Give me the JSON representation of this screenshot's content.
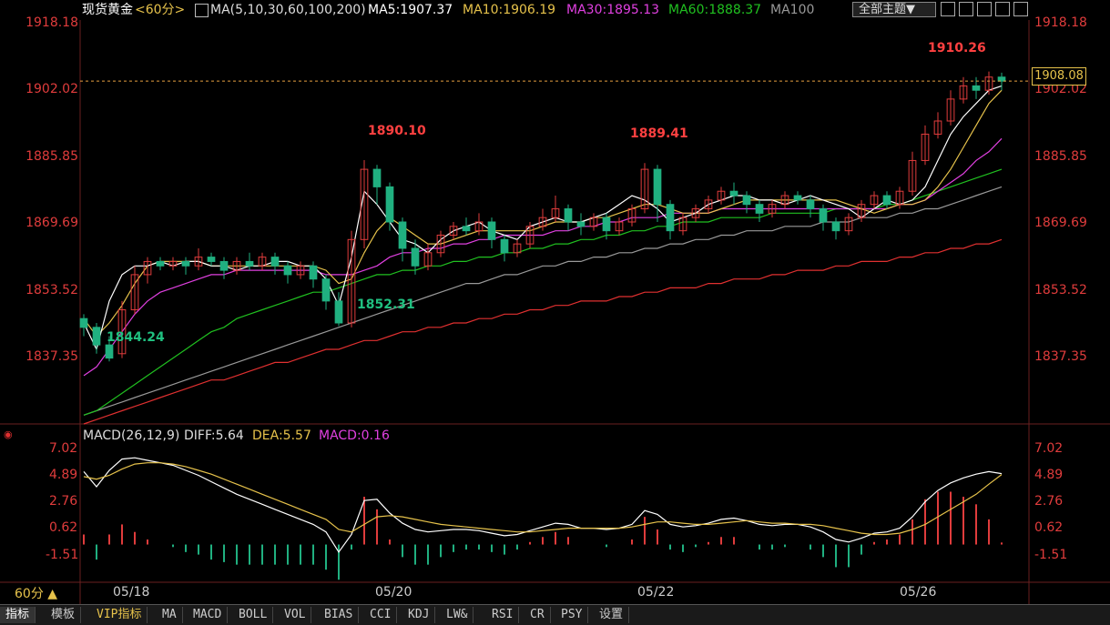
{
  "header": {
    "instrument": "现货黄金",
    "period": "<60分>",
    "ma_params": "MA(5,10,30,60,100,200)",
    "ma5": "MA5:1907.37",
    "ma10": "MA10:1906.19",
    "ma30": "MA30:1895.13",
    "ma60": "MA60:1888.37",
    "ma100": "MA100",
    "theme_button": "全部主题▼"
  },
  "colors": {
    "ma5": "#ffffff",
    "ma10": "#e6c24b",
    "ma30": "#e040e0",
    "ma60": "#20c020",
    "ma100": "#999999",
    "ma200": "#e03030",
    "up": "#e03c3c",
    "down": "#20b080"
  },
  "price_axis": {
    "labels_left": [
      "1918.18",
      "1902.02",
      "1885.85",
      "1869.69",
      "1853.52",
      "1837.35"
    ],
    "labels_right": [
      "1918.18",
      "1902.02",
      "1885.85",
      "1869.69",
      "1853.52",
      "1837.35"
    ],
    "current_price": "1908.08"
  },
  "annotations": {
    "low1": "1844.24",
    "low2": "1852.31",
    "high1": "1890.10",
    "high2": "1889.41",
    "high3": "1910.26"
  },
  "macd": {
    "title": "MACD(26,12,9)",
    "diff": "DIFF:5.64",
    "dea": "DEA:5.57",
    "macd": "MACD:0.16",
    "labels_left": [
      "7.02",
      "4.89",
      "2.76",
      "0.62",
      "-1.51"
    ],
    "labels_right": [
      "7.02",
      "4.89",
      "2.76",
      "0.62",
      "-1.51"
    ]
  },
  "xaxis": {
    "labels": [
      "05/18",
      "05/20",
      "05/22",
      "05/26"
    ]
  },
  "period_button": "60分 ▲",
  "tabs": [
    "指标",
    "模板",
    "VIP指标",
    "MA",
    "MACD",
    "BOLL",
    "VOL",
    "BIAS",
    "CCI",
    "KDJ",
    "LW&",
    "RSI",
    "CR",
    "PSY",
    "设置"
  ],
  "chart_data": [
    {
      "type": "candlestick",
      "title": "现货黄金 60分",
      "ylim": [
        1830,
        1922
      ],
      "series": [
        {
          "name": "MA5",
          "value": 1907.37
        },
        {
          "name": "MA10",
          "value": 1906.19
        },
        {
          "name": "MA30",
          "value": 1895.13
        },
        {
          "name": "MA60",
          "value": 1888.37
        },
        {
          "name": "MA100"
        }
      ],
      "ma_curves": {
        "MA5": [
          1853,
          1847,
          1858,
          1864,
          1866,
          1866,
          1867,
          1866,
          1867,
          1867,
          1866,
          1866,
          1865,
          1866,
          1866,
          1867,
          1867,
          1866,
          1866,
          1863,
          1857,
          1868,
          1883,
          1880,
          1876,
          1872,
          1871,
          1869,
          1872,
          1874,
          1875,
          1876,
          1874,
          1873,
          1872,
          1875,
          1876,
          1877,
          1876,
          1876,
          1877,
          1878,
          1880,
          1882,
          1881,
          1879,
          1876,
          1877,
          1878,
          1880,
          1881,
          1882,
          1882,
          1881,
          1881,
          1880,
          1881,
          1882,
          1881,
          1880,
          1879,
          1877,
          1879,
          1881,
          1880,
          1881,
          1884,
          1890,
          1896,
          1900,
          1903,
          1906,
          1907
        ],
        "MA10": [
          1854,
          1850,
          1853,
          1857,
          1862,
          1866,
          1867,
          1867,
          1867,
          1867,
          1866,
          1866,
          1866,
          1866,
          1866,
          1866,
          1866,
          1866,
          1866,
          1865,
          1862,
          1863,
          1869,
          1874,
          1877,
          1875,
          1873,
          1871,
          1871,
          1872,
          1873,
          1874,
          1874,
          1874,
          1874,
          1874,
          1875,
          1876,
          1876,
          1876,
          1877,
          1877,
          1878,
          1879,
          1880,
          1880,
          1879,
          1878,
          1878,
          1878,
          1879,
          1880,
          1881,
          1881,
          1881,
          1881,
          1881,
          1881,
          1881,
          1881,
          1880,
          1879,
          1878,
          1879,
          1880,
          1880,
          1881,
          1884,
          1888,
          1893,
          1898,
          1903,
          1906
        ],
        "MA30": [
          1841,
          1843,
          1847,
          1851,
          1855,
          1858,
          1860,
          1861,
          1862,
          1863,
          1864,
          1864,
          1865,
          1865,
          1865,
          1865,
          1865,
          1865,
          1865,
          1864,
          1864,
          1864,
          1865,
          1866,
          1868,
          1869,
          1869,
          1870,
          1870,
          1871,
          1871,
          1872,
          1872,
          1873,
          1873,
          1873,
          1873,
          1874,
          1874,
          1875,
          1875,
          1876,
          1876,
          1877,
          1877,
          1877,
          1878,
          1878,
          1878,
          1878,
          1879,
          1879,
          1879,
          1879,
          1879,
          1879,
          1879,
          1879,
          1879,
          1879,
          1879,
          1879,
          1879,
          1879,
          1880,
          1880,
          1881,
          1883,
          1885,
          1887,
          1890,
          1892,
          1895
        ],
        "MA60": [
          1832,
          1833,
          1835,
          1837,
          1839,
          1841,
          1843,
          1845,
          1847,
          1849,
          1851,
          1852,
          1854,
          1855,
          1856,
          1857,
          1858,
          1859,
          1860,
          1860,
          1861,
          1862,
          1863,
          1864,
          1864,
          1865,
          1865,
          1866,
          1866,
          1867,
          1867,
          1868,
          1868,
          1869,
          1869,
          1870,
          1870,
          1871,
          1871,
          1872,
          1872,
          1873,
          1873,
          1874,
          1874,
          1875,
          1875,
          1876,
          1876,
          1876,
          1877,
          1877,
          1877,
          1877,
          1878,
          1878,
          1878,
          1878,
          1878,
          1879,
          1879,
          1879,
          1879,
          1880,
          1880,
          1881,
          1882,
          1883,
          1884,
          1885,
          1886,
          1887,
          1888
        ],
        "MA100": [
          1832,
          1833,
          1834,
          1835,
          1836,
          1837,
          1838,
          1839,
          1840,
          1841,
          1842,
          1843,
          1844,
          1845,
          1846,
          1847,
          1848,
          1849,
          1850,
          1851,
          1852,
          1853,
          1854,
          1855,
          1856,
          1857,
          1858,
          1859,
          1860,
          1861,
          1862,
          1862,
          1863,
          1864,
          1864,
          1865,
          1866,
          1866,
          1867,
          1867,
          1868,
          1868,
          1869,
          1869,
          1870,
          1870,
          1871,
          1871,
          1872,
          1872,
          1873,
          1873,
          1874,
          1874,
          1874,
          1875,
          1875,
          1875,
          1876,
          1876,
          1876,
          1877,
          1877,
          1877,
          1878,
          1878,
          1879,
          1879,
          1880,
          1881,
          1882,
          1883,
          1884
        ],
        "MA200": [
          1830,
          1831,
          1832,
          1833,
          1834,
          1835,
          1836,
          1837,
          1838,
          1839,
          1840,
          1840,
          1841,
          1842,
          1843,
          1844,
          1844,
          1845,
          1846,
          1847,
          1847,
          1848,
          1849,
          1849,
          1850,
          1851,
          1851,
          1852,
          1852,
          1853,
          1853,
          1854,
          1854,
          1855,
          1855,
          1856,
          1856,
          1857,
          1857,
          1858,
          1858,
          1858,
          1859,
          1859,
          1860,
          1860,
          1861,
          1861,
          1861,
          1862,
          1862,
          1863,
          1863,
          1863,
          1864,
          1864,
          1865,
          1865,
          1865,
          1866,
          1866,
          1867,
          1867,
          1867,
          1868,
          1868,
          1869,
          1869,
          1870,
          1870,
          1871,
          1871,
          1872
        ]
      },
      "candles": [
        [
          1854,
          1852,
          1855,
          1850
        ],
        [
          1852,
          1848,
          1853,
          1846
        ],
        [
          1848,
          1845,
          1850,
          1844.24
        ],
        [
          1846,
          1856,
          1858,
          1845
        ],
        [
          1856,
          1864,
          1866,
          1855
        ],
        [
          1864,
          1867,
          1868,
          1862
        ],
        [
          1867,
          1866,
          1868,
          1865
        ],
        [
          1866,
          1867,
          1868,
          1865
        ],
        [
          1867,
          1866,
          1868,
          1864
        ],
        [
          1866,
          1868,
          1870,
          1865
        ],
        [
          1868,
          1867,
          1869,
          1866
        ],
        [
          1867,
          1865,
          1868,
          1863
        ],
        [
          1865,
          1867,
          1868,
          1864
        ],
        [
          1867,
          1866,
          1869,
          1865
        ],
        [
          1866,
          1868,
          1869,
          1865
        ],
        [
          1868,
          1866,
          1869,
          1864
        ],
        [
          1866,
          1864,
          1867,
          1862
        ],
        [
          1864,
          1866,
          1867,
          1863
        ],
        [
          1866,
          1863,
          1867,
          1861
        ],
        [
          1863,
          1858,
          1864,
          1856
        ],
        [
          1858,
          1853,
          1860,
          1852.31
        ],
        [
          1853,
          1872,
          1874,
          1852
        ],
        [
          1872,
          1888,
          1890.1,
          1870
        ],
        [
          1888,
          1884,
          1889,
          1880
        ],
        [
          1884,
          1876,
          1885,
          1874
        ],
        [
          1876,
          1870,
          1877,
          1867
        ],
        [
          1870,
          1866,
          1872,
          1864
        ],
        [
          1866,
          1869,
          1871,
          1865
        ],
        [
          1869,
          1873,
          1874,
          1868
        ],
        [
          1873,
          1875,
          1876,
          1872
        ],
        [
          1875,
          1874,
          1877,
          1873
        ],
        [
          1874,
          1876,
          1878,
          1873
        ],
        [
          1876,
          1872,
          1877,
          1870
        ],
        [
          1872,
          1869,
          1873,
          1867
        ],
        [
          1869,
          1871,
          1872,
          1868
        ],
        [
          1871,
          1875,
          1876,
          1870
        ],
        [
          1875,
          1877,
          1879,
          1874
        ],
        [
          1877,
          1879,
          1882,
          1876
        ],
        [
          1879,
          1876,
          1880,
          1874
        ],
        [
          1876,
          1875,
          1878,
          1873
        ],
        [
          1875,
          1877,
          1878,
          1874
        ],
        [
          1877,
          1874,
          1878,
          1872
        ],
        [
          1874,
          1876,
          1877,
          1873
        ],
        [
          1876,
          1879,
          1880,
          1875
        ],
        [
          1879,
          1888,
          1889.41,
          1878
        ],
        [
          1888,
          1880,
          1889,
          1876
        ],
        [
          1880,
          1874,
          1881,
          1872
        ],
        [
          1874,
          1877,
          1878,
          1873
        ],
        [
          1877,
          1879,
          1880,
          1876
        ],
        [
          1879,
          1881,
          1882,
          1878
        ],
        [
          1881,
          1883,
          1884,
          1880
        ],
        [
          1883,
          1882,
          1885,
          1880
        ],
        [
          1882,
          1880,
          1883,
          1878
        ],
        [
          1880,
          1878,
          1881,
          1876
        ],
        [
          1878,
          1880,
          1881,
          1877
        ],
        [
          1880,
          1882,
          1883,
          1879
        ],
        [
          1882,
          1881,
          1883,
          1880
        ],
        [
          1881,
          1879,
          1882,
          1877
        ],
        [
          1879,
          1876,
          1880,
          1874
        ],
        [
          1876,
          1874,
          1877,
          1872
        ],
        [
          1874,
          1877,
          1878,
          1873
        ],
        [
          1877,
          1880,
          1881,
          1876
        ],
        [
          1880,
          1882,
          1883,
          1879
        ],
        [
          1882,
          1880,
          1883,
          1879
        ],
        [
          1880,
          1883,
          1884,
          1879
        ],
        [
          1883,
          1890,
          1892,
          1882
        ],
        [
          1890,
          1896,
          1898,
          1889
        ],
        [
          1896,
          1899,
          1901,
          1895
        ],
        [
          1899,
          1904,
          1906,
          1898
        ],
        [
          1904,
          1907,
          1909,
          1903
        ],
        [
          1907,
          1906,
          1909,
          1904
        ],
        [
          1906,
          1909,
          1910.26,
          1905
        ],
        [
          1909,
          1908.08,
          1910,
          1906
        ]
      ]
    },
    {
      "type": "macd",
      "title": "MACD(26,12,9)",
      "ylim": [
        -3,
        8
      ],
      "series": [
        {
          "name": "DIFF",
          "value": 5.64
        },
        {
          "name": "DEA",
          "value": 5.57
        },
        {
          "name": "MACD",
          "value": 0.16
        }
      ],
      "diff": [
        5.8,
        4.6,
        5.9,
        6.8,
        6.9,
        6.7,
        6.5,
        6.3,
        5.9,
        5.5,
        5.0,
        4.5,
        4.0,
        3.6,
        3.2,
        2.8,
        2.4,
        2.0,
        1.6,
        1.0,
        -0.6,
        0.8,
        3.5,
        3.6,
        2.5,
        1.7,
        1.2,
        1.0,
        1.1,
        1.2,
        1.2,
        1.1,
        0.9,
        0.7,
        0.8,
        1.1,
        1.4,
        1.7,
        1.6,
        1.3,
        1.3,
        1.2,
        1.3,
        1.6,
        2.7,
        2.4,
        1.6,
        1.4,
        1.5,
        1.7,
        2.0,
        2.1,
        1.9,
        1.6,
        1.5,
        1.6,
        1.6,
        1.4,
        1.0,
        0.4,
        0.2,
        0.5,
        0.9,
        1.0,
        1.3,
        2.2,
        3.4,
        4.3,
        4.9,
        5.3,
        5.6,
        5.8,
        5.64
      ],
      "dea": [
        5.4,
        5.2,
        5.5,
        6.0,
        6.4,
        6.5,
        6.5,
        6.4,
        6.2,
        5.9,
        5.6,
        5.2,
        4.8,
        4.4,
        4.0,
        3.6,
        3.2,
        2.8,
        2.4,
        2.0,
        1.2,
        1.0,
        1.6,
        2.2,
        2.3,
        2.2,
        2.0,
        1.8,
        1.6,
        1.5,
        1.4,
        1.3,
        1.2,
        1.1,
        1.0,
        1.0,
        1.1,
        1.2,
        1.3,
        1.3,
        1.3,
        1.3,
        1.3,
        1.4,
        1.6,
        1.8,
        1.8,
        1.7,
        1.6,
        1.6,
        1.7,
        1.8,
        1.9,
        1.8,
        1.7,
        1.7,
        1.6,
        1.6,
        1.5,
        1.3,
        1.1,
        0.9,
        0.8,
        0.8,
        0.9,
        1.2,
        1.6,
        2.2,
        2.8,
        3.4,
        4.0,
        4.8,
        5.57
      ],
      "macd": [
        0.8,
        -1.2,
        0.8,
        1.6,
        1.0,
        0.4,
        0,
        -0.2,
        -0.6,
        -0.8,
        -1.2,
        -1.4,
        -1.6,
        -1.6,
        -1.6,
        -1.6,
        -1.6,
        -1.6,
        -1.6,
        -2.0,
        -2.8,
        -0.4,
        3.8,
        2.8,
        0.4,
        -1.0,
        -1.6,
        -1.6,
        -1.0,
        -0.6,
        -0.4,
        -0.4,
        -0.6,
        -0.8,
        -0.4,
        0.2,
        0.6,
        1.0,
        0.6,
        0,
        0,
        -0.2,
        0,
        0.4,
        2.2,
        1.2,
        -0.4,
        -0.6,
        -0.2,
        0.2,
        0.6,
        0.6,
        0,
        -0.4,
        -0.4,
        -0.2,
        0,
        -0.4,
        -1.0,
        -1.8,
        -1.8,
        -0.8,
        0.2,
        0.4,
        0.8,
        2.0,
        3.6,
        4.2,
        4.2,
        3.8,
        3.2,
        2.0,
        0.16
      ]
    }
  ]
}
